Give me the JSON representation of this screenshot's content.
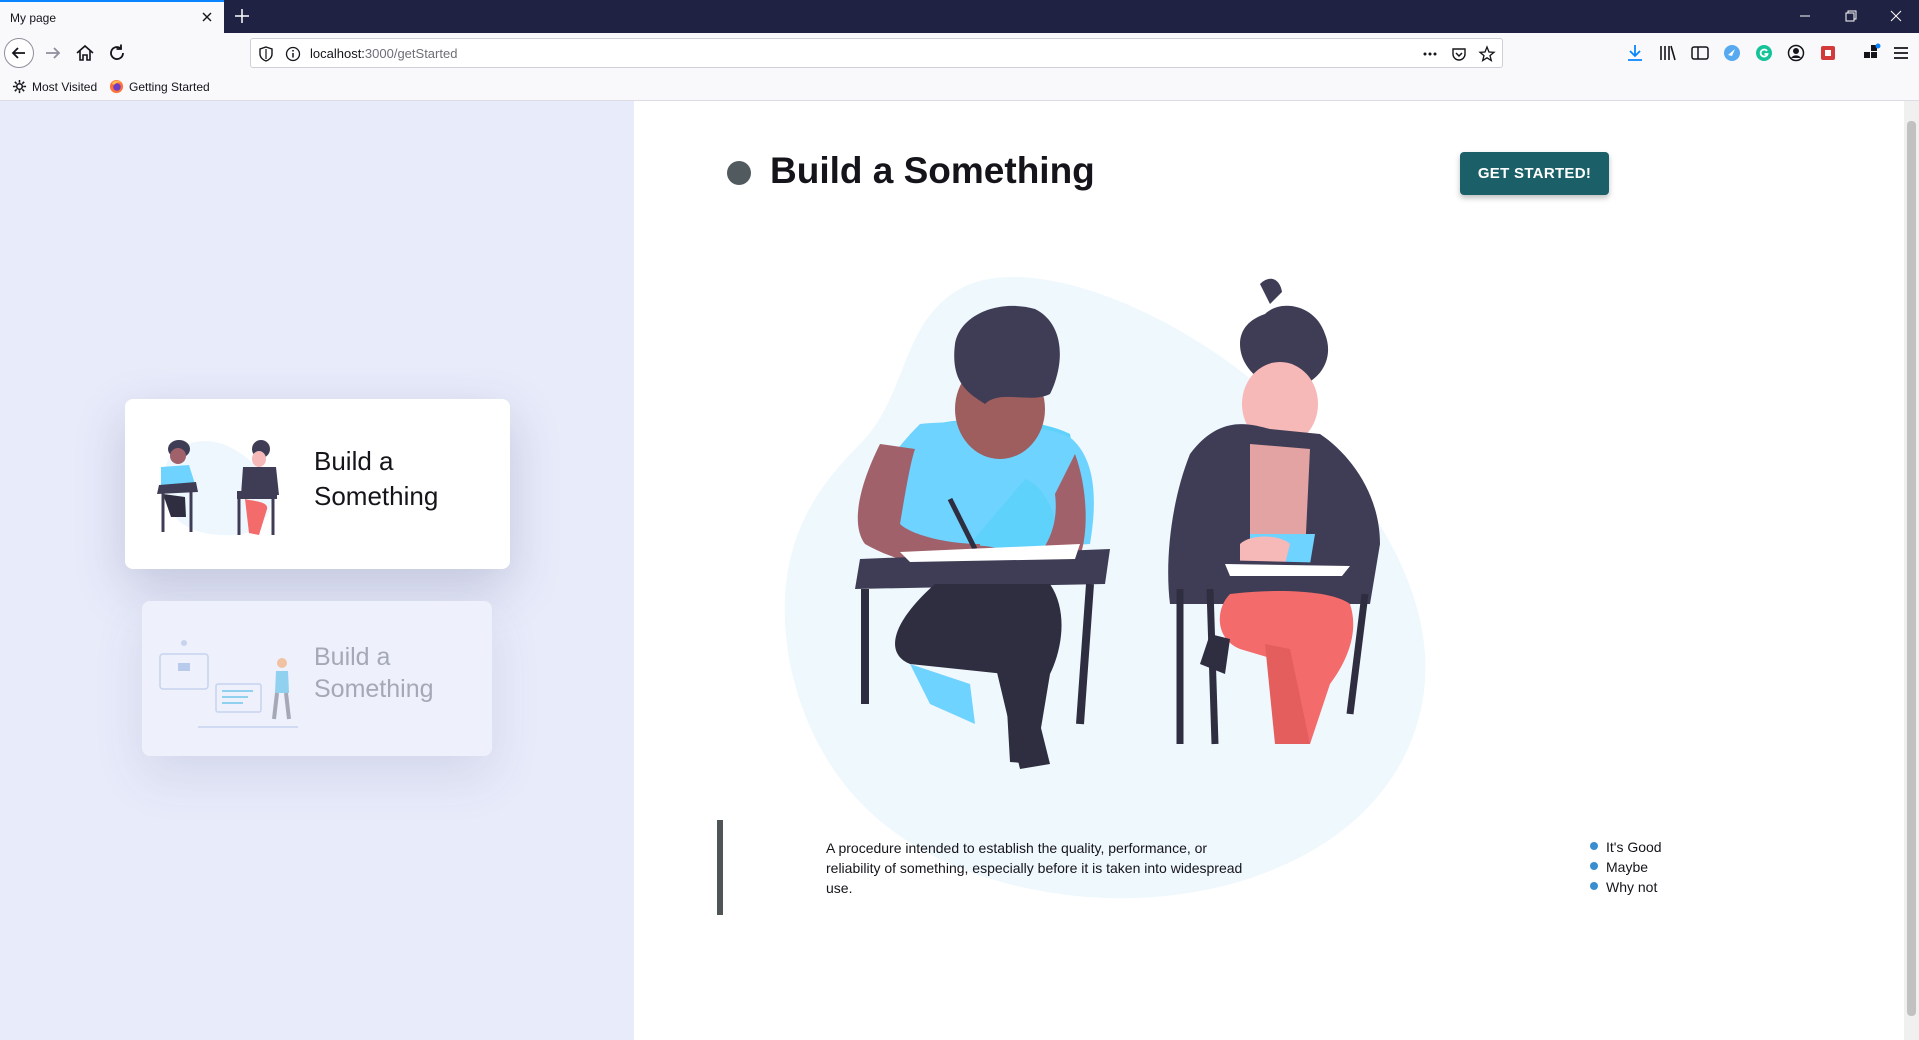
{
  "browser": {
    "tab_title": "My page",
    "url_host": "localhost:",
    "url_path": "3000/getStarted",
    "bookmarks": [
      "Most Visited",
      "Getting Started"
    ]
  },
  "sidebar": {
    "cards": [
      {
        "title": "Build a Something",
        "state": "active"
      },
      {
        "title": "Build a Something",
        "state": "inactive"
      }
    ]
  },
  "main": {
    "heading": "Build a Something",
    "cta_label": "GET STARTED!",
    "description": "A procedure intended to establish the quality, performance, or reliability of something, especially before it is taken into widespread use.",
    "bullets": [
      "It's Good",
      "Maybe",
      "Why not"
    ]
  },
  "colors": {
    "accent": "#1b6068",
    "sidebar_bg": "#e8ebfa",
    "bullet": "#3a8ecf"
  }
}
